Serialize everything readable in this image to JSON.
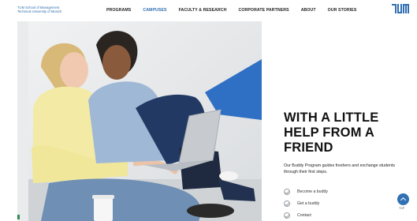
{
  "brand": {
    "line1": "TUM School of Management",
    "line2": "Technical University of Munich"
  },
  "nav": {
    "items": [
      {
        "label": "PROGRAMS",
        "active": false
      },
      {
        "label": "CAMPUSES",
        "active": true
      },
      {
        "label": "FACULTY & RESEARCH",
        "active": false
      },
      {
        "label": "CORPORATE PARTNERS",
        "active": false
      },
      {
        "label": "ABOUT",
        "active": false
      },
      {
        "label": "OUR STORIES",
        "active": false
      }
    ]
  },
  "logo": {
    "icon": "tum-logo"
  },
  "hero": {
    "image_subject": "two students looking at a laptop"
  },
  "headline": {
    "line1": "WITH A LITTLE",
    "line2": "HELP FROM A",
    "line3": "FRIEND"
  },
  "description": "Our Buddy Program guides freshers and exchange students through their first steps.",
  "links": [
    {
      "label": "Become a buddy",
      "icon": "check-circle-icon"
    },
    {
      "label": "Get a buddy",
      "icon": "check-circle-icon"
    },
    {
      "label": "Contact",
      "icon": "check-circle-icon"
    }
  ],
  "scroll_top": {
    "label": "TOP",
    "icon": "chevron-up-icon"
  },
  "colors": {
    "accent": "#3070b3",
    "text": "#111111"
  }
}
